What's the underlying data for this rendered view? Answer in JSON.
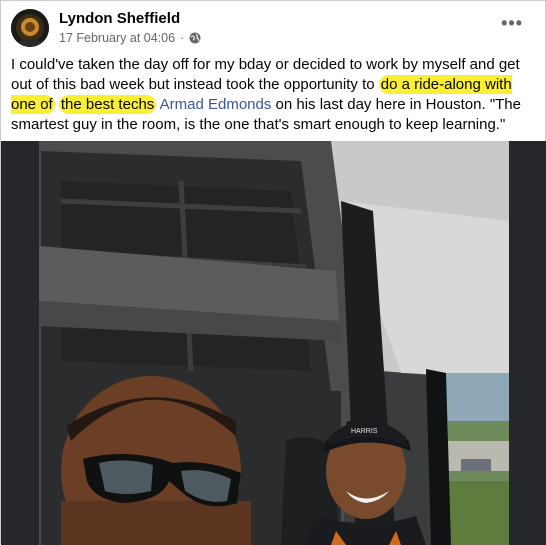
{
  "post": {
    "author": "Lyndon Sheffield",
    "timestamp": "17 February at 04:06",
    "separator": "·",
    "more_label": "•••",
    "text": {
      "part1": "I could've taken the day off for my bday or decided to work by myself and get out of this bad week but instead took the opportunity to ",
      "highlight1": "do a ride-along with one of",
      "space": " ",
      "highlight2": "the best techs",
      "mention": "Armad Edmonds",
      "part2": " on his last day here in Houston. \"The smartest guy in the room, is the one that's smart enough to keep learning.\""
    },
    "photo": {
      "cap_text": "HARRIS"
    }
  },
  "colors": {
    "highlight": "#fbef34",
    "link": "#385898",
    "meta": "#65676b"
  },
  "icons": {
    "privacy": "globe-icon",
    "more": "more-options-icon"
  }
}
